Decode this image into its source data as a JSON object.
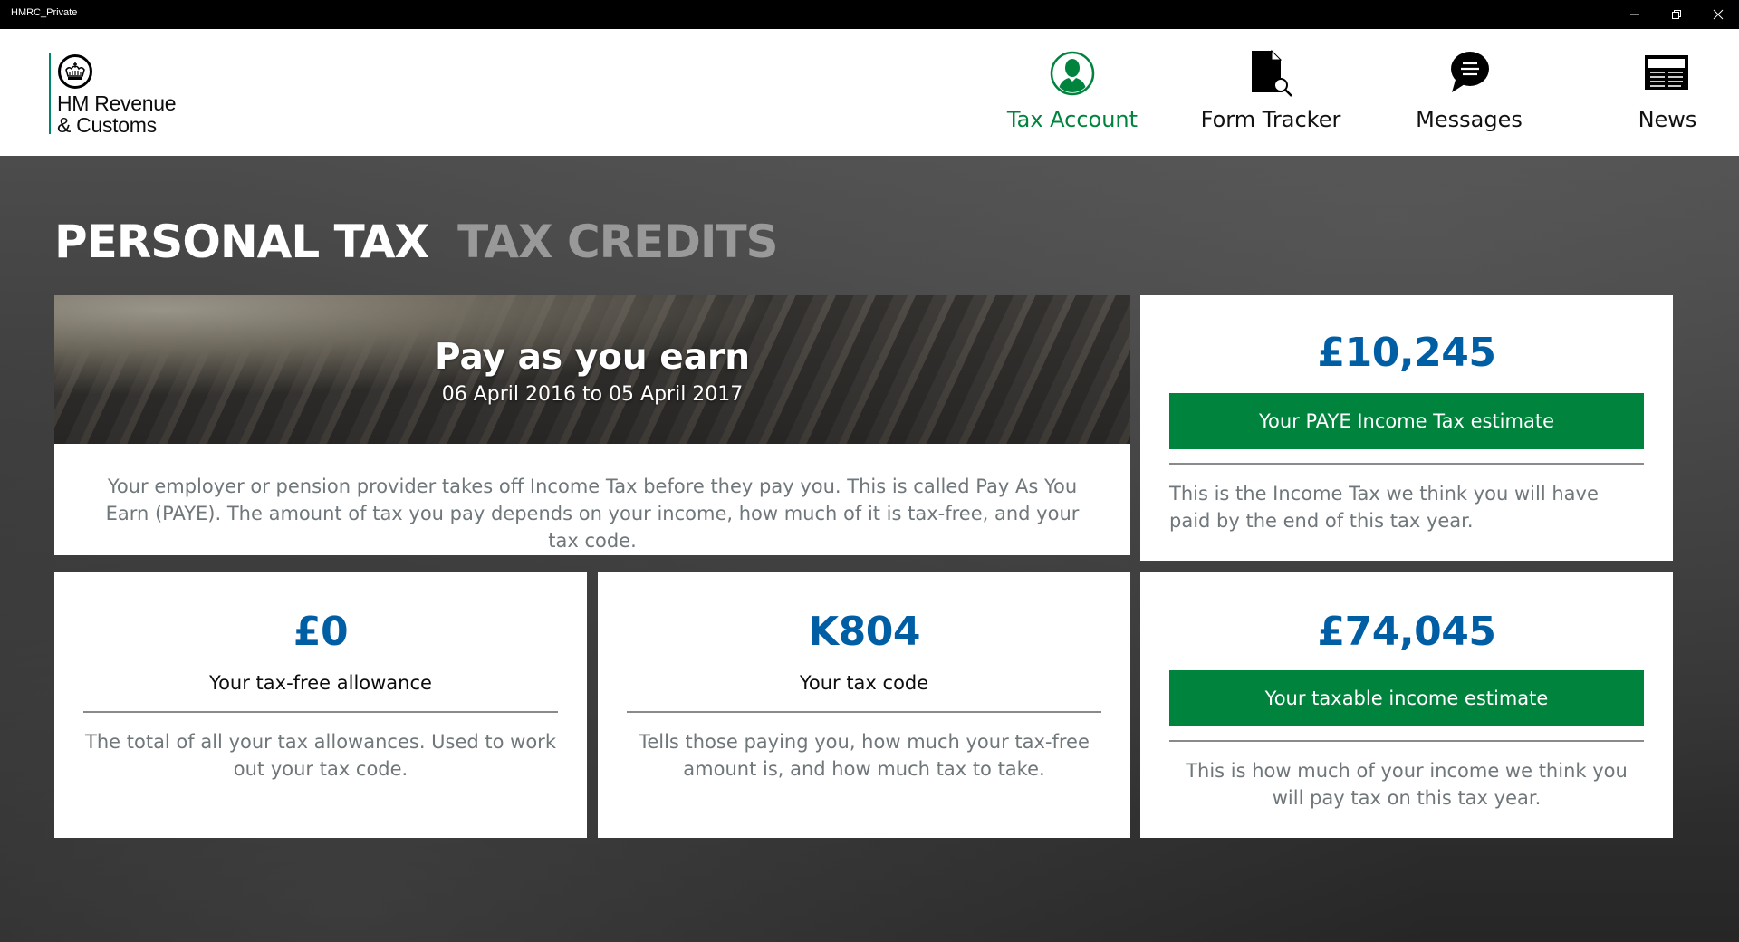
{
  "window": {
    "title": "HMRC_Private",
    "controls": {
      "minimize": "—",
      "restore": "❐",
      "close": "✕"
    }
  },
  "logo": {
    "line1": "HM Revenue",
    "line2": "& Customs",
    "icon": "crown-icon"
  },
  "nav": [
    {
      "label": "Tax Account",
      "icon": "person-icon",
      "active": true
    },
    {
      "label": "Form Tracker",
      "icon": "document-search-icon",
      "active": false
    },
    {
      "label": "Messages",
      "icon": "chat-bubble-icon",
      "active": false
    },
    {
      "label": "News",
      "icon": "newspaper-icon",
      "active": false
    }
  ],
  "section_tabs": [
    {
      "label": "PERSONAL TAX",
      "active": true
    },
    {
      "label": "TAX CREDITS",
      "active": false
    }
  ],
  "banner": {
    "title": "Pay as you earn",
    "dates": "06 April 2016 to 05 April 2017",
    "description": "Your employer or pension provider takes off Income Tax before they pay you. This is called Pay As You Earn (PAYE). The amount of tax you pay depends on your income, how much of it is tax-free, and your tax code."
  },
  "cards": {
    "paye": {
      "value": "£10,245",
      "button": "Your PAYE Income Tax estimate",
      "description": "This is the Income Tax we think you will have paid by the end of this tax year."
    },
    "allowance": {
      "value": "£0",
      "label": "Your tax-free allowance",
      "description": "The total of all your tax allowances. Used to work out your tax code."
    },
    "tax_code": {
      "value": "K804",
      "label": "Your tax code",
      "description": "Tells those paying you, how much your tax-free amount is, and how much tax to take."
    },
    "taxable": {
      "value": "£74,045",
      "button": "Your taxable income estimate",
      "description": "This is how much of your income we think you will pay tax on this tax year."
    }
  },
  "colors": {
    "brand_green": "#00843d",
    "value_blue": "#005ea5",
    "logo_teal": "#008670",
    "muted_text": "#6f777b"
  }
}
